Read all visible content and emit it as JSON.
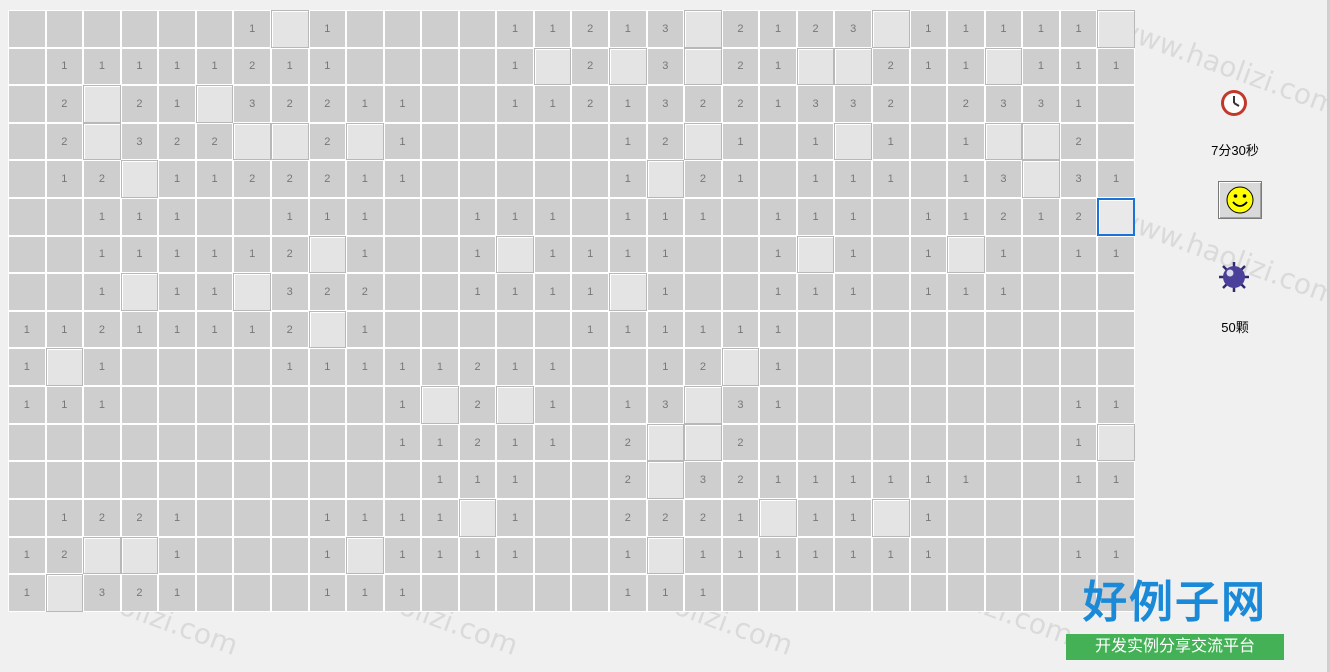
{
  "status": {
    "time_text": "7分30秒",
    "mine_count_text": "50颗"
  },
  "icons": {
    "timer": "clock-icon",
    "face": "smiley-face-icon",
    "mines": "mine-icon"
  },
  "watermark": {
    "text": "www.haolizi.com"
  },
  "logo": {
    "main": "好例子网",
    "sub": "开发实例分享交流平台"
  },
  "colors": {
    "revealed": "#cecece",
    "closed": "#e4e4e4",
    "number": "#777777",
    "selected_border": "#1a73d9",
    "smiley": "#ffff00",
    "logo_blue": "#1a8ad8",
    "logo_green": "#45b157"
  },
  "board": {
    "cols": 30,
    "rows": 16,
    "selected": [
      5,
      29
    ],
    "grid": [
      [
        "",
        "",
        "",
        "",
        "",
        "",
        "1",
        "#",
        "1",
        "",
        "",
        "",
        "",
        "1",
        "1",
        "2",
        "1",
        "3",
        "#",
        "2",
        "1",
        "2",
        "3",
        "#",
        "1",
        "1",
        "1",
        "1",
        "1",
        "#"
      ],
      [
        "",
        "1",
        "1",
        "1",
        "1",
        "1",
        "2",
        "1",
        "1",
        "",
        "",
        "",
        "",
        "1",
        "#",
        "2",
        "#",
        "3",
        "#",
        "2",
        "1",
        "#",
        "#",
        "2",
        "1",
        "1",
        "#",
        "1",
        "1",
        "1"
      ],
      [
        "",
        "2",
        "#",
        "2",
        "1",
        "#",
        "3",
        "2",
        "2",
        "1",
        "1",
        "",
        "",
        "1",
        "1",
        "2",
        "1",
        "3",
        "2",
        "2",
        "1",
        "3",
        "3",
        "2",
        "",
        "2",
        "3",
        "3",
        "1",
        ""
      ],
      [
        "",
        "2",
        "#",
        "3",
        "2",
        "2",
        "#",
        "#",
        "2",
        "#",
        "1",
        "",
        "",
        "",
        "",
        "",
        "1",
        "2",
        "#",
        "1",
        "",
        "1",
        "#",
        "1",
        "",
        "1",
        "#",
        "#",
        "2",
        ""
      ],
      [
        "",
        "1",
        "2",
        "#",
        "1",
        "1",
        "2",
        "2",
        "2",
        "1",
        "1",
        "",
        "",
        "",
        "",
        "",
        "1",
        "#",
        "2",
        "1",
        "",
        "1",
        "1",
        "1",
        "",
        "1",
        "3",
        "#",
        "3",
        "1"
      ],
      [
        "",
        "",
        "1",
        "1",
        "1",
        "",
        "",
        "1",
        "1",
        "1",
        "",
        "",
        "1",
        "1",
        "1",
        "",
        "1",
        "1",
        "1",
        "",
        "1",
        "1",
        "1",
        "",
        "1",
        "1",
        "2",
        "1",
        "2",
        "#"
      ],
      [
        "",
        "",
        "1",
        "1",
        "1",
        "1",
        "1",
        "2",
        "#",
        "1",
        "",
        "",
        "1",
        "#",
        "1",
        "1",
        "1",
        "1",
        "",
        "",
        "1",
        "#",
        "1",
        "",
        "1",
        "#",
        "1",
        "",
        "1",
        "1"
      ],
      [
        "",
        "",
        "1",
        "#",
        "1",
        "1",
        "#",
        "3",
        "2",
        "2",
        "",
        "",
        "1",
        "1",
        "1",
        "1",
        "#",
        "1",
        "",
        "",
        "1",
        "1",
        "1",
        "",
        "1",
        "1",
        "1",
        "",
        "",
        ""
      ],
      [
        "1",
        "1",
        "2",
        "1",
        "1",
        "1",
        "1",
        "2",
        "#",
        "1",
        "",
        "",
        "",
        "",
        "",
        "1",
        "1",
        "1",
        "1",
        "1",
        "1",
        "",
        "",
        "",
        "",
        "",
        "",
        "",
        "",
        ""
      ],
      [
        "1",
        "#",
        "1",
        "",
        "",
        "",
        "",
        "1",
        "1",
        "1",
        "1",
        "1",
        "2",
        "1",
        "1",
        "",
        "",
        "1",
        "2",
        "#",
        "1",
        "",
        "",
        "",
        "",
        "",
        "",
        "",
        "",
        ""
      ],
      [
        "1",
        "1",
        "1",
        "",
        "",
        "",
        "",
        "",
        "",
        "",
        "1",
        "#",
        "2",
        "#",
        "1",
        "",
        "1",
        "3",
        "#",
        "3",
        "1",
        "",
        "",
        "",
        "",
        "",
        "",
        "",
        "1",
        "1"
      ],
      [
        "",
        "",
        "",
        "",
        "",
        "",
        "",
        "",
        "",
        "",
        "1",
        "1",
        "2",
        "1",
        "1",
        "",
        "2",
        "#",
        "#",
        "2",
        "",
        "",
        "",
        "",
        "",
        "",
        "",
        "",
        "1",
        "#"
      ],
      [
        "",
        "",
        "",
        "",
        "",
        "",
        "",
        "",
        "",
        "",
        "",
        "1",
        "1",
        "1",
        "",
        "",
        "2",
        "#",
        "3",
        "2",
        "1",
        "1",
        "1",
        "1",
        "1",
        "1",
        "",
        "",
        "1",
        "1"
      ],
      [
        "",
        "1",
        "2",
        "2",
        "1",
        "",
        "",
        "",
        "1",
        "1",
        "1",
        "1",
        "#",
        "1",
        "",
        "",
        "2",
        "2",
        "2",
        "1",
        "#",
        "1",
        "1",
        "#",
        "1",
        "",
        "",
        "",
        "",
        ""
      ],
      [
        "1",
        "2",
        "#",
        "#",
        "1",
        "",
        "",
        "",
        "1",
        "#",
        "1",
        "1",
        "1",
        "1",
        "",
        "",
        "1",
        "#",
        "1",
        "1",
        "1",
        "1",
        "1",
        "1",
        "1",
        "",
        "",
        "",
        "1",
        "1"
      ],
      [
        "1",
        "#",
        "3",
        "2",
        "1",
        "",
        "",
        "",
        "1",
        "1",
        "1",
        "",
        "",
        "",
        "",
        "",
        "1",
        "1",
        "1",
        "",
        "",
        "",
        "",
        "",
        "",
        "",
        "",
        "",
        "",
        ""
      ]
    ]
  }
}
